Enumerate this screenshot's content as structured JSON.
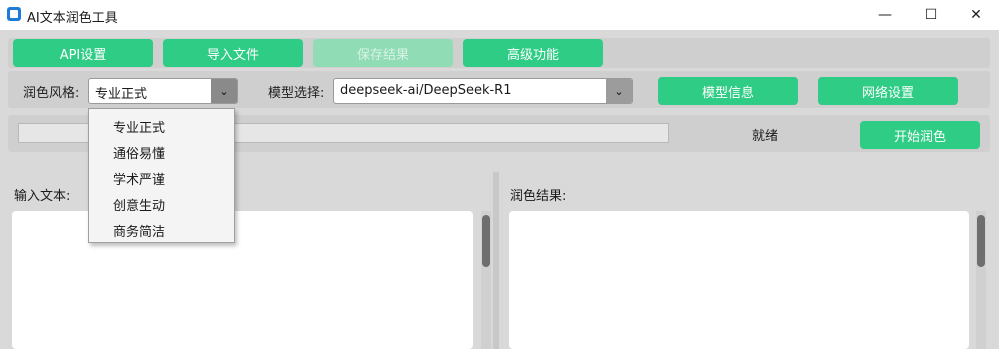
{
  "window": {
    "title": "AI文本润色工具",
    "minimize_glyph": "—",
    "maximize_glyph": "☐",
    "close_glyph": "✕"
  },
  "toolbar": {
    "api_settings": "API设置",
    "import_file": "导入文件",
    "save_result": "保存结果",
    "advanced": "高级功能"
  },
  "style": {
    "label": "润色风格:",
    "selected": "专业正式",
    "options": [
      "专业正式",
      "通俗易懂",
      "学术严谨",
      "创意生动",
      "商务简洁"
    ]
  },
  "model": {
    "label": "模型选择:",
    "selected": "deepseek-ai/DeepSeek-R1",
    "info_button": "模型信息",
    "network_button": "网络设置"
  },
  "progress": {
    "status": "就绪",
    "value": 0,
    "start_button": "开始润色"
  },
  "input": {
    "label": "输入文本:",
    "text": ""
  },
  "output": {
    "label": "润色结果:",
    "text": ""
  },
  "colors": {
    "accent": "#2ecc84",
    "accent_disabled": "#90dcb5"
  },
  "icons": {
    "app": "app-icon",
    "dropdown_arrow": "chevron-down-icon"
  }
}
